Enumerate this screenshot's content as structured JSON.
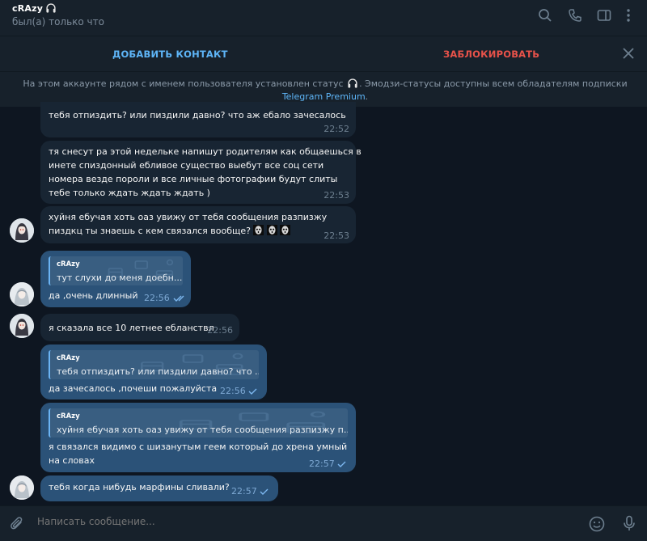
{
  "header": {
    "name": "cRAzy",
    "status": "был(а) только что",
    "icons": [
      "search-icon",
      "phone-icon",
      "sidebar-toggle-icon",
      "more-vert-icon"
    ]
  },
  "actions": {
    "add_contact": "ДОБАВИТЬ КОНТАКТ",
    "block": "ЗАБЛОКИРОВАТЬ"
  },
  "notice": {
    "before": "На этом аккаунте рядом с именем пользователя установлен статус",
    "after": ". Эмодзи-статусы доступны всем обладателям подписки",
    "link": "Telegram Premium",
    "end": "."
  },
  "messages": [
    {
      "dir": "in",
      "lines": [
        "тебя отпиздить? или пиздили давно? что аж ебало зачесалось"
      ],
      "time": "22:52"
    },
    {
      "dir": "in",
      "lines": [
        "тя снесут ра этой недельке напишут родителям как общаешься в",
        "инете спиздонный ебливое существо выебут все соц сети",
        "номера везде пороли и все личные фотографии будут слиты",
        "тебе только ждать ждать ждать )"
      ],
      "time": "22:53"
    },
    {
      "dir": "in",
      "lines": [
        "хуйня ебучая хоть оаз увижу от тебя сообщения разпизжу",
        "пиздкц ты знаешь с кем связался вообще?"
      ],
      "time": "22:53"
    },
    {
      "dir": "out",
      "reply_name": "cRAzy",
      "reply_text": "тут слухи до меня доебн...",
      "lines": [
        "да ,очень длинный"
      ],
      "time": "22:56"
    },
    {
      "dir": "in",
      "lines": [
        "я сказала все 10 летнее ебланствл"
      ],
      "time": "22:56"
    },
    {
      "dir": "out",
      "reply_name": "cRAzy",
      "reply_text": "тебя отпиздить? или пиздили давно? что ...",
      "lines": [
        "да зачесалось ,почеши пожалуйста"
      ],
      "time": "22:56"
    },
    {
      "dir": "out",
      "reply_name": "cRAzy",
      "reply_text": "хуйня ебучая хоть оаз увижу от тебя сообщения разпизжу п...",
      "lines": [
        "я связался видимо с шизанутым геем который до хрена умный",
        "на словах"
      ],
      "time": "22:57"
    },
    {
      "dir": "out",
      "lines": [
        "тебя когда нибудь марфины сливали?"
      ],
      "time": "22:57"
    }
  ],
  "input": {
    "placeholder": "Написать сообщение..."
  },
  "colors": {
    "accent": "#5eb5f7",
    "danger": "#e8524a",
    "bubble_in": "#182533",
    "bubble_out": "#2b5278",
    "background": "#0e1621"
  }
}
